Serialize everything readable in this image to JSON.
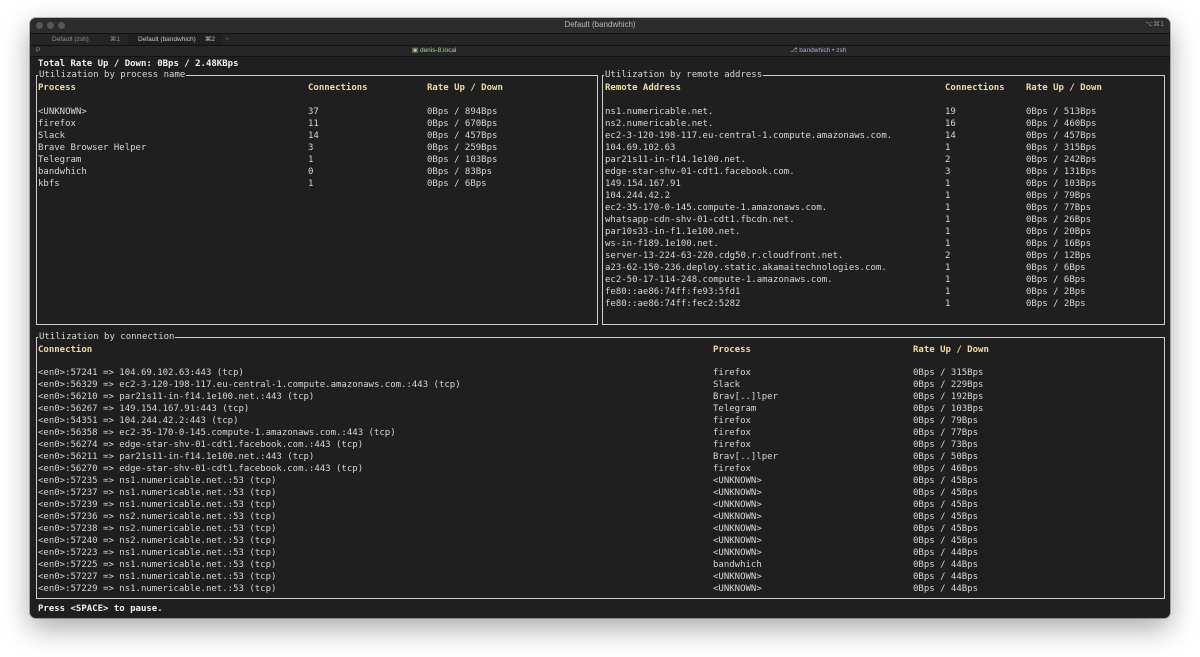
{
  "window": {
    "title": "Default (bandwhich)",
    "title_shortcut": "⌥⌘1"
  },
  "tabs": [
    {
      "label": "Default (zsh)",
      "shortcut": "⌘1"
    },
    {
      "label": "Default (bandwhich)",
      "shortcut": "⌘2"
    }
  ],
  "new_tab_label": "+",
  "statusbar": {
    "command_glyph": "P",
    "host": "denis-8.local",
    "job": "bandwhich • zsh"
  },
  "total_rate": "Total Rate Up / Down: 0Bps / 2.48KBps",
  "process_panel": {
    "title": "Utilization by process name",
    "headers": [
      "Process",
      "Connections",
      "Rate Up / Down"
    ],
    "rows": [
      [
        "<UNKNOWN>",
        "37",
        "0Bps / 894Bps"
      ],
      [
        "firefox",
        "11",
        "0Bps / 670Bps"
      ],
      [
        "Slack",
        "14",
        "0Bps / 457Bps"
      ],
      [
        "Brave Browser Helper",
        "3",
        "0Bps / 259Bps"
      ],
      [
        "Telegram",
        "1",
        "0Bps / 103Bps"
      ],
      [
        "bandwhich",
        "0",
        "0Bps / 83Bps"
      ],
      [
        "kbfs",
        "1",
        "0Bps / 6Bps"
      ]
    ]
  },
  "remote_panel": {
    "title": "Utilization by remote address",
    "headers": [
      "Remote Address",
      "Connections",
      "Rate Up / Down"
    ],
    "rows": [
      [
        "ns1.numericable.net.",
        "19",
        "0Bps / 513Bps"
      ],
      [
        "ns2.numericable.net.",
        "16",
        "0Bps / 460Bps"
      ],
      [
        "ec2-3-120-198-117.eu-central-1.compute.amazonaws.com.",
        "14",
        "0Bps / 457Bps"
      ],
      [
        "104.69.102.63",
        "1",
        "0Bps / 315Bps"
      ],
      [
        "par21s11-in-f14.1e100.net.",
        "2",
        "0Bps / 242Bps"
      ],
      [
        "edge-star-shv-01-cdt1.facebook.com.",
        "3",
        "0Bps / 131Bps"
      ],
      [
        "149.154.167.91",
        "1",
        "0Bps / 103Bps"
      ],
      [
        "104.244.42.2",
        "1",
        "0Bps / 79Bps"
      ],
      [
        "ec2-35-170-0-145.compute-1.amazonaws.com.",
        "1",
        "0Bps / 77Bps"
      ],
      [
        "whatsapp-cdn-shv-01-cdt1.fbcdn.net.",
        "1",
        "0Bps / 26Bps"
      ],
      [
        "par10s33-in-f1.1e100.net.",
        "1",
        "0Bps / 20Bps"
      ],
      [
        "ws-in-f189.1e100.net.",
        "1",
        "0Bps / 16Bps"
      ],
      [
        "server-13-224-63-220.cdg50.r.cloudfront.net.",
        "2",
        "0Bps / 12Bps"
      ],
      [
        "a23-62-150-236.deploy.static.akamaitechnologies.com.",
        "1",
        "0Bps / 6Bps"
      ],
      [
        "ec2-50-17-114-248.compute-1.amazonaws.com.",
        "1",
        "0Bps / 6Bps"
      ],
      [
        "fe80::ae86:74ff:fe93:5fd1",
        "1",
        "0Bps / 2Bps"
      ],
      [
        "fe80::ae86:74ff:fec2:5282",
        "1",
        "0Bps / 2Bps"
      ]
    ]
  },
  "connection_panel": {
    "title": "Utilization by connection",
    "headers": [
      "Connection",
      "Process",
      "Rate Up / Down"
    ],
    "rows": [
      [
        "<en0>:57241 => 104.69.102.63:443 (tcp)",
        "firefox",
        "0Bps / 315Bps"
      ],
      [
        "<en0>:56329 => ec2-3-120-198-117.eu-central-1.compute.amazonaws.com.:443 (tcp)",
        "Slack",
        "0Bps / 229Bps"
      ],
      [
        "<en0>:56210 => par21s11-in-f14.1e100.net.:443 (tcp)",
        "Brav[..]lper",
        "0Bps / 192Bps"
      ],
      [
        "<en0>:56267 => 149.154.167.91:443 (tcp)",
        "Telegram",
        "0Bps / 103Bps"
      ],
      [
        "<en0>:54351 => 104.244.42.2:443 (tcp)",
        "firefox",
        "0Bps / 79Bps"
      ],
      [
        "<en0>:56358 => ec2-35-170-0-145.compute-1.amazonaws.com.:443 (tcp)",
        "firefox",
        "0Bps / 77Bps"
      ],
      [
        "<en0>:56274 => edge-star-shv-01-cdt1.facebook.com.:443 (tcp)",
        "firefox",
        "0Bps / 73Bps"
      ],
      [
        "<en0>:56211 => par21s11-in-f14.1e100.net.:443 (tcp)",
        "Brav[..]lper",
        "0Bps / 50Bps"
      ],
      [
        "<en0>:56270 => edge-star-shv-01-cdt1.facebook.com.:443 (tcp)",
        "firefox",
        "0Bps / 46Bps"
      ],
      [
        "<en0>:57235 => ns1.numericable.net.:53 (tcp)",
        "<UNKNOWN>",
        "0Bps / 45Bps"
      ],
      [
        "<en0>:57237 => ns1.numericable.net.:53 (tcp)",
        "<UNKNOWN>",
        "0Bps / 45Bps"
      ],
      [
        "<en0>:57239 => ns1.numericable.net.:53 (tcp)",
        "<UNKNOWN>",
        "0Bps / 45Bps"
      ],
      [
        "<en0>:57236 => ns2.numericable.net.:53 (tcp)",
        "<UNKNOWN>",
        "0Bps / 45Bps"
      ],
      [
        "<en0>:57238 => ns2.numericable.net.:53 (tcp)",
        "<UNKNOWN>",
        "0Bps / 45Bps"
      ],
      [
        "<en0>:57240 => ns2.numericable.net.:53 (tcp)",
        "<UNKNOWN>",
        "0Bps / 45Bps"
      ],
      [
        "<en0>:57223 => ns1.numericable.net.:53 (tcp)",
        "<UNKNOWN>",
        "0Bps / 44Bps"
      ],
      [
        "<en0>:57225 => ns1.numericable.net.:53 (tcp)",
        "bandwhich",
        "0Bps / 44Bps"
      ],
      [
        "<en0>:57227 => ns1.numericable.net.:53 (tcp)",
        "<UNKNOWN>",
        "0Bps / 44Bps"
      ],
      [
        "<en0>:57229 => ns1.numericable.net.:53 (tcp)",
        "<UNKNOWN>",
        "0Bps / 44Bps"
      ]
    ]
  },
  "footer": "Press <SPACE> to pause."
}
